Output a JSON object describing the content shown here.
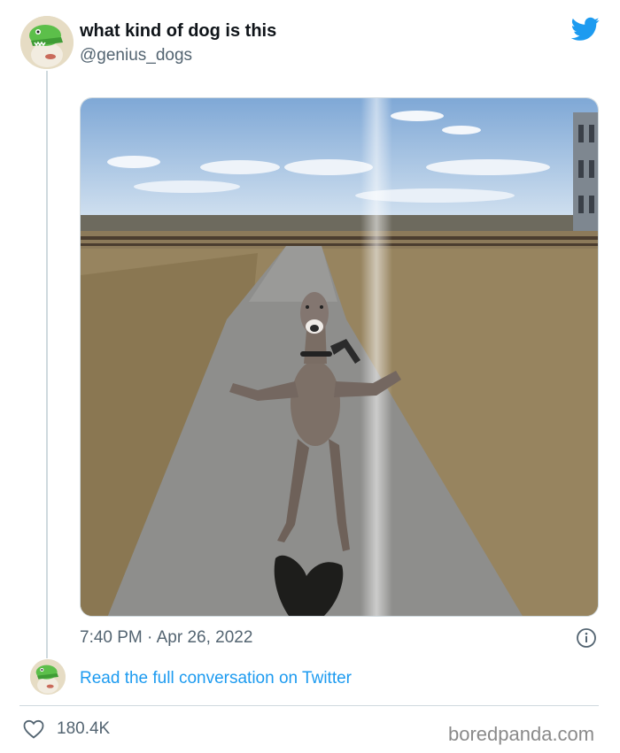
{
  "tweet": {
    "display_name": "what kind of dog is this",
    "handle": "@genius_dogs",
    "timestamp": "7:40 PM · Apr 26, 2022",
    "read_more": "Read the full conversation on Twitter",
    "like_count": "180.4K"
  },
  "icons": {
    "brand": "twitter-bird-icon",
    "info": "info-icon",
    "like": "heart-icon"
  },
  "media": {
    "description_kind": "photo"
  },
  "watermark": "boredpanda.com",
  "colors": {
    "twitter_blue": "#1d9bf0",
    "text_primary": "#0f1419",
    "text_secondary": "#536471",
    "border": "#cfd9de"
  }
}
